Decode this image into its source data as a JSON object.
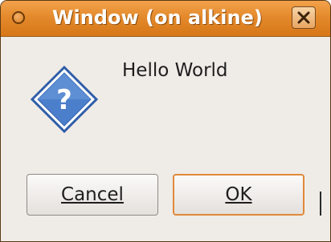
{
  "window": {
    "title": "Window (on alkine)"
  },
  "titlebar": {
    "menu_icon": "window-menu-icon",
    "close_icon": "close-icon"
  },
  "dialog": {
    "icon": "question-icon",
    "message": "Hello World"
  },
  "buttons": {
    "cancel_label": "Cancel",
    "ok_label": "OK"
  },
  "colors": {
    "titlebar": "#e48a2c",
    "default_button_border": "#e0893a",
    "icon_blue": "#3d6fbf"
  }
}
